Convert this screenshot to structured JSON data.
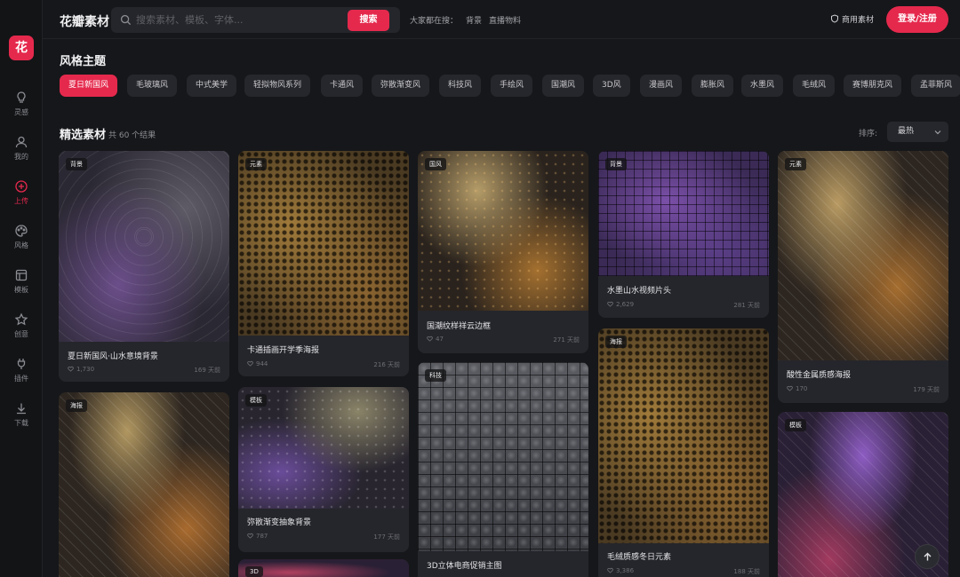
{
  "sidebar": {
    "logo": "花",
    "items": [
      {
        "label": "灵感",
        "icon": "lightbulb-icon"
      },
      {
        "label": "我的",
        "icon": "user-icon"
      },
      {
        "label": "上传",
        "icon": "plus-circle-icon",
        "active": true
      },
      {
        "label": "风格",
        "icon": "palette-icon"
      },
      {
        "label": "模板",
        "icon": "template-icon"
      },
      {
        "label": "创意",
        "icon": "star-icon"
      },
      {
        "label": "插件",
        "icon": "plug-icon"
      },
      {
        "label": "下载",
        "icon": "download-icon"
      }
    ]
  },
  "header": {
    "brand": "花瓣素材",
    "search_placeholder": "搜索素材、模板、字体...",
    "search_button": "搜索",
    "hot_label": "大家都在搜：",
    "hot_links": [
      "背景",
      "直播物料"
    ],
    "commercial": "商用素材",
    "login": "登录/注册"
  },
  "themes": {
    "title": "风格主题",
    "chips": [
      "夏日新国风",
      "毛玻璃风",
      "中式美学",
      "轻拟物风系列",
      "卡通风",
      "弥散渐变风",
      "科技风",
      "手绘风",
      "国潮风",
      "3D风",
      "漫画风",
      "膨胀风",
      "水墨风",
      "毛绒风",
      "赛博朋克风",
      "孟菲斯风"
    ]
  },
  "featured": {
    "title": "精选素材",
    "count": "共 60 个结果",
    "sort_label": "排序:",
    "sort_value": "最热",
    "cards": [
      {
        "badge": "背景",
        "title": "夏日新国风·山水意境背景",
        "likes": "1,730",
        "time": "169 天前"
      },
      {
        "badge": "元素",
        "title": "卡通插画开学季海报",
        "likes": "944",
        "time": "216 天前"
      },
      {
        "badge": "国风",
        "title": "国潮纹样祥云边框",
        "likes": "47",
        "time": "271 天前"
      },
      {
        "badge": "背景",
        "title": "水墨山水视频片头",
        "likes": "2,629",
        "time": "281 天前"
      },
      {
        "badge": "元素",
        "title": "酸性金属质感海报",
        "likes": "170",
        "time": "179 天前"
      },
      {
        "badge": "海报",
        "title": "",
        "likes": "",
        "time": ""
      },
      {
        "badge": "模板",
        "title": "弥散渐变抽象背景",
        "likes": "787",
        "time": "177 天前"
      },
      {
        "badge": "科技",
        "title": "3D立体电商促销主图",
        "likes": "",
        "time": ""
      },
      {
        "badge": "海报",
        "title": "毛绒质感冬日元素",
        "likes": "3,386",
        "time": "188 天前"
      },
      {
        "badge": "模板",
        "title": "",
        "likes": "",
        "time": ""
      },
      {
        "badge": "3D",
        "title": "",
        "likes": "",
        "time": ""
      }
    ]
  }
}
